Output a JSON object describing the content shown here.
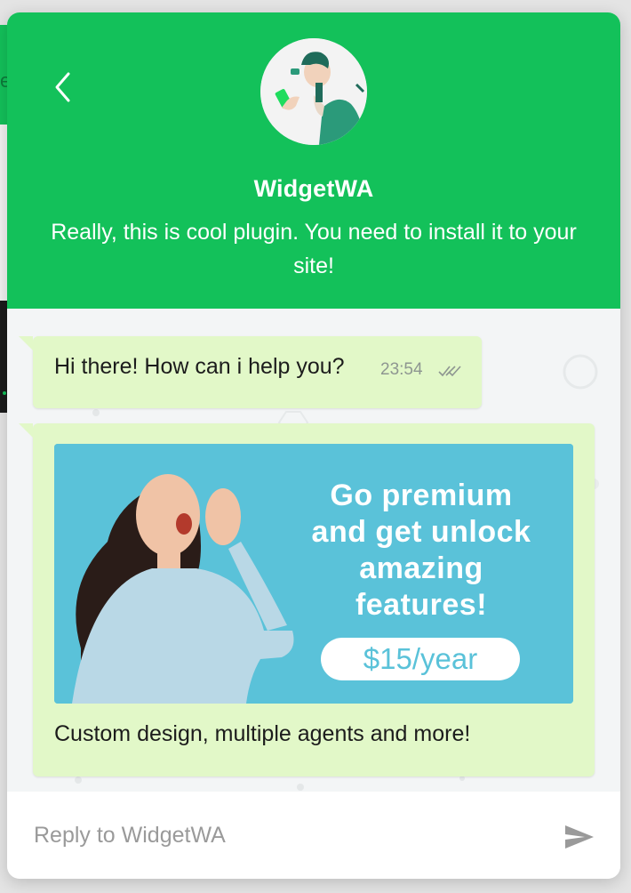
{
  "header": {
    "agent_name": "WidgetWA",
    "description": "Really, this is cool plugin. You need to install it to your site!",
    "back_icon": "chevron-left-icon",
    "avatar": "agent-avatar-illustration"
  },
  "messages": [
    {
      "text": "Hi there! How can i help you?",
      "time": "23:54",
      "status_icon": "double-check-icon"
    },
    {
      "promo_lines": [
        "Go premium",
        "and get unlock",
        "amazing",
        "features!"
      ],
      "price": "$15/year",
      "caption": "Custom design, multiple agents and more!"
    }
  ],
  "reply": {
    "placeholder": "Reply to WidgetWA",
    "send_icon": "send-icon"
  },
  "colors": {
    "brand_green": "#13c15a",
    "bubble_green": "#e2f8c8",
    "promo_blue": "#5ac2d9"
  }
}
